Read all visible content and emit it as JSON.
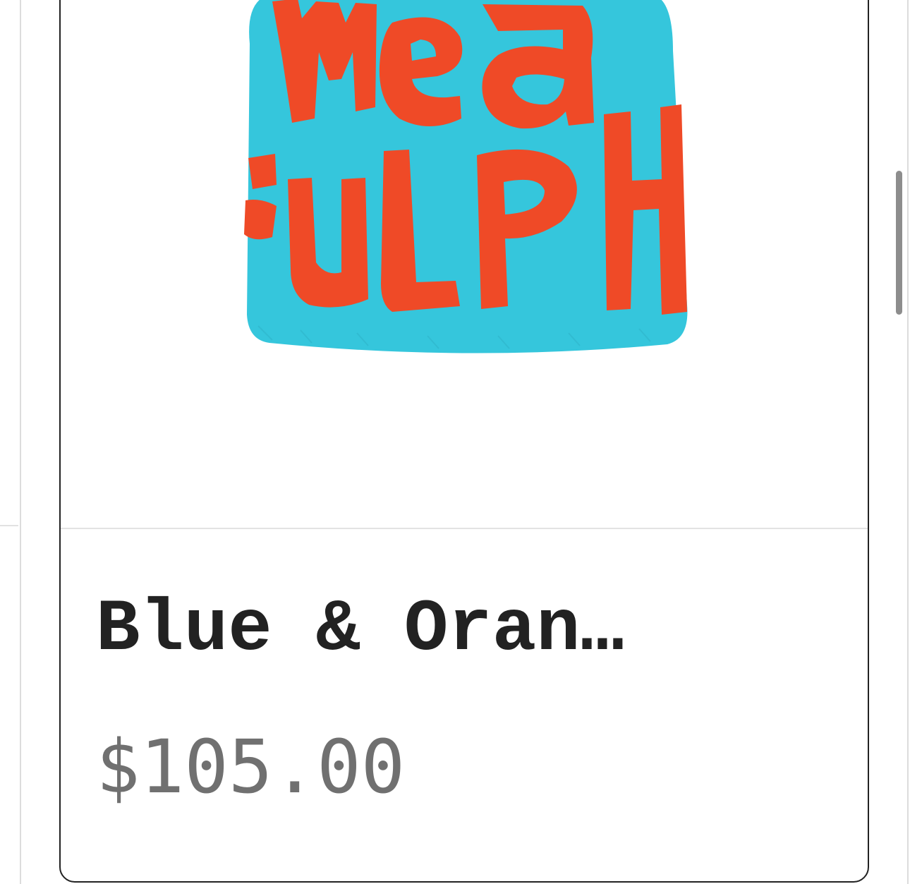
{
  "product": {
    "title": "Blue & Oran…",
    "price": "$105.00",
    "image": {
      "icon": "beanie-hat-image",
      "printed_text": "mea culpa",
      "base_color": "#35c6dc",
      "print_color": "#ef4a27"
    }
  }
}
